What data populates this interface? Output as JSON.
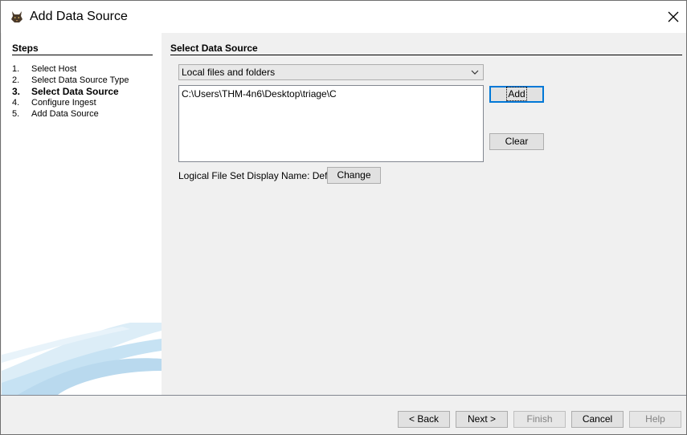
{
  "window": {
    "title": "Add Data Source"
  },
  "steps": {
    "title": "Steps",
    "items": [
      {
        "num": "1.",
        "label": "Select Host"
      },
      {
        "num": "2.",
        "label": "Select Data Source Type"
      },
      {
        "num": "3.",
        "label": "Select Data Source"
      },
      {
        "num": "4.",
        "label": "Configure Ingest"
      },
      {
        "num": "5.",
        "label": "Add Data Source"
      }
    ],
    "current_index": 2
  },
  "main": {
    "section_title": "Select Data Source",
    "source_type_selected": "Local files and folders",
    "paths": [
      "C:\\Users\\THM-4n6\\Desktop\\triage\\C"
    ],
    "add_label": "Add",
    "clear_label": "Clear",
    "display_name_label": "Logical File Set Display Name: Default",
    "change_label": "Change"
  },
  "footer": {
    "back_label": "< Back",
    "next_label": "Next >",
    "finish_label": "Finish",
    "cancel_label": "Cancel",
    "help_label": "Help"
  },
  "icons": {
    "app": "autopsy-dog-icon",
    "close": "close-icon",
    "dropdown": "chevron-down-icon"
  },
  "colors": {
    "focus_border": "#0078d7",
    "panel_bg": "#f0f0f0",
    "swoosh": "#b9d9ee"
  }
}
